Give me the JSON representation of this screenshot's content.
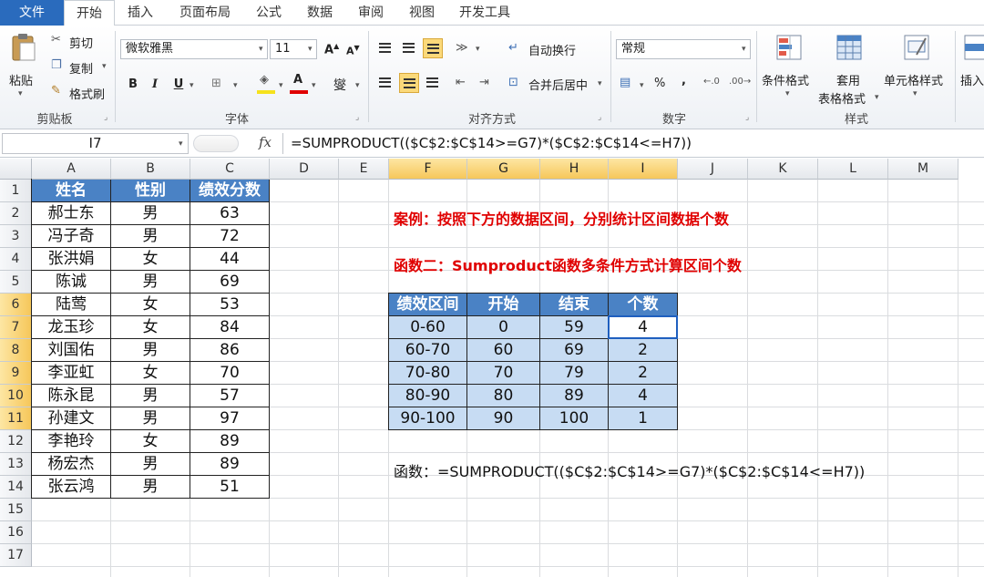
{
  "ribbon_tabs": [
    "文件",
    "开始",
    "插入",
    "页面布局",
    "公式",
    "数据",
    "审阅",
    "视图",
    "开发工具"
  ],
  "clipboard": {
    "paste": "粘贴",
    "cut": "剪切",
    "copy": "复制",
    "format_painter": "格式刷",
    "group": "剪贴板"
  },
  "font": {
    "name": "微软雅黑",
    "size": "11",
    "group": "字体",
    "bold": "B",
    "italic": "I",
    "underline": "U",
    "phonetic": "燮"
  },
  "alignment": {
    "wrap": "自动换行",
    "merge": "合并后居中",
    "group": "对齐方式"
  },
  "number": {
    "format": "常规",
    "percent": "%",
    "comma": ",",
    "group": "数字"
  },
  "styles": {
    "conditional": "条件格式",
    "table_format_1": "套用",
    "table_format_2": "表格格式",
    "cell_styles": "单元格样式",
    "group": "样式"
  },
  "cells": {
    "insert": "插入"
  },
  "formula_bar": {
    "name_box": "I7",
    "fx": "fx",
    "formula": "=SUMPRODUCT(($C$2:$C$14>=G7)*($C$2:$C$14<=H7))"
  },
  "columns": [
    "A",
    "B",
    "C",
    "D",
    "E",
    "F",
    "G",
    "H",
    "I",
    "J",
    "K",
    "L",
    "M"
  ],
  "rows": [
    "1",
    "2",
    "3",
    "4",
    "5",
    "6",
    "7",
    "8",
    "9",
    "10",
    "11",
    "12",
    "13",
    "14",
    "15",
    "16",
    "17"
  ],
  "active_cell": "I7",
  "data_table": {
    "headers": [
      "姓名",
      "性别",
      "绩效分数"
    ],
    "rows": [
      [
        "郝士东",
        "男",
        "63"
      ],
      [
        "冯子奇",
        "男",
        "72"
      ],
      [
        "张洪娟",
        "女",
        "44"
      ],
      [
        "陈诚",
        "男",
        "69"
      ],
      [
        "陆莺",
        "女",
        "53"
      ],
      [
        "龙玉珍",
        "女",
        "84"
      ],
      [
        "刘国佑",
        "男",
        "86"
      ],
      [
        "李亚虹",
        "女",
        "70"
      ],
      [
        "陈永昆",
        "男",
        "57"
      ],
      [
        "孙建文",
        "男",
        "97"
      ],
      [
        "李艳玲",
        "女",
        "89"
      ],
      [
        "杨宏杰",
        "男",
        "89"
      ],
      [
        "张云鸿",
        "男",
        "51"
      ]
    ]
  },
  "notes": {
    "case": "案例：按照下方的数据区间，分别统计区间数据个数",
    "method": "函数二：Sumproduct函数多条件方式计算区间个数",
    "formula_text": "函数：=SUMPRODUCT(($C$2:$C$14>=G7)*($C$2:$C$14<=H7))"
  },
  "range_table": {
    "headers": [
      "绩效区间",
      "开始",
      "结束",
      "个数"
    ],
    "rows": [
      [
        "0-60",
        "0",
        "59",
        "4"
      ],
      [
        "60-70",
        "60",
        "69",
        "2"
      ],
      [
        "70-80",
        "70",
        "79",
        "2"
      ],
      [
        "80-90",
        "80",
        "89",
        "4"
      ],
      [
        "90-100",
        "90",
        "100",
        "1"
      ]
    ]
  },
  "colors": {
    "header_blue": "#4a82c5",
    "range_fill": "#c7dcf3",
    "accent_red": "#e00000",
    "file_tab": "#2a6bbd",
    "selected_header": "#f6c75a"
  }
}
